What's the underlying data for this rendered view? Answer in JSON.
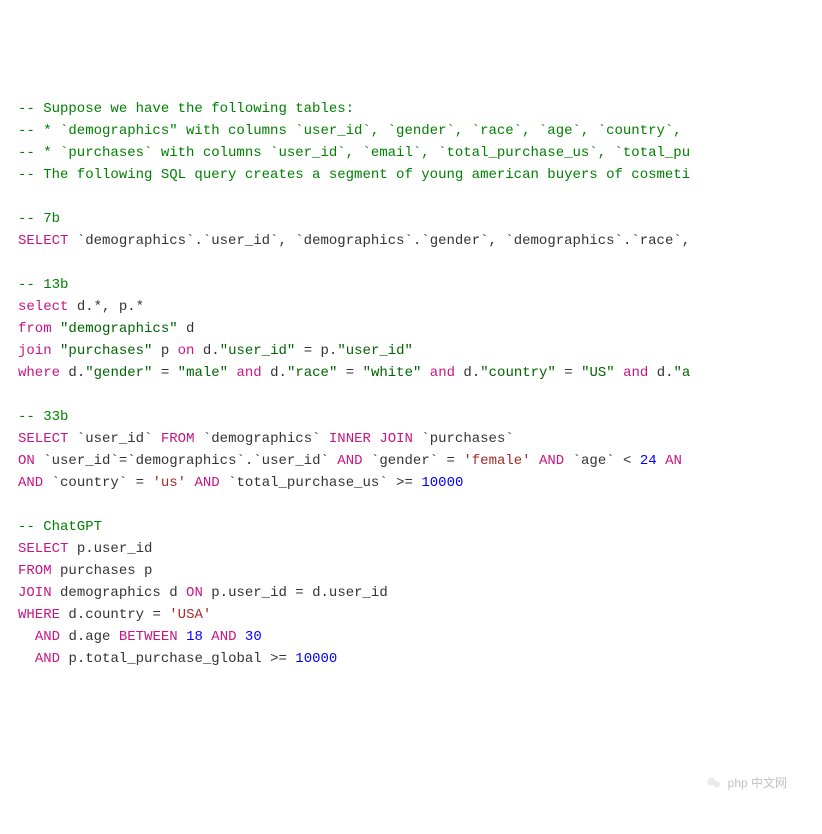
{
  "lines": [
    {
      "type": "comment",
      "text": "-- Suppose we have the following tables:"
    },
    {
      "type": "comment",
      "text": "-- * `demographics\" with columns `user_id`, `gender`, `race`, `age`, `country`, "
    },
    {
      "type": "comment",
      "text": "-- * `purchases` with columns `user_id`, `email`, `total_purchase_us`, `total_pu"
    },
    {
      "type": "comment",
      "text": "-- The following SQL query creates a segment of young american buyers of cosmeti"
    },
    {
      "type": "blank"
    },
    {
      "type": "comment",
      "text": "-- 7b"
    },
    {
      "type": "tokens",
      "tokens": [
        {
          "t": "keyword",
          "v": "SELECT"
        },
        {
          "t": "sp",
          "v": " "
        },
        {
          "t": "ident",
          "v": "`demographics`.`user_id`"
        },
        {
          "t": "op",
          "v": ", "
        },
        {
          "t": "ident",
          "v": "`demographics`.`gender`"
        },
        {
          "t": "op",
          "v": ", "
        },
        {
          "t": "ident",
          "v": "`demographics`.`race`"
        },
        {
          "t": "op",
          "v": ", "
        }
      ]
    },
    {
      "type": "blank"
    },
    {
      "type": "comment",
      "text": "-- 13b"
    },
    {
      "type": "tokens",
      "tokens": [
        {
          "t": "keyword",
          "v": "select"
        },
        {
          "t": "sp",
          "v": " "
        },
        {
          "t": "ident",
          "v": "d."
        },
        {
          "t": "op",
          "v": "*"
        },
        {
          "t": "op",
          "v": ", "
        },
        {
          "t": "ident",
          "v": "p."
        },
        {
          "t": "op",
          "v": "*"
        }
      ]
    },
    {
      "type": "tokens",
      "tokens": [
        {
          "t": "keyword",
          "v": "from"
        },
        {
          "t": "sp",
          "v": " "
        },
        {
          "t": "string",
          "v": "\"demographics\""
        },
        {
          "t": "sp",
          "v": " "
        },
        {
          "t": "ident",
          "v": "d"
        }
      ]
    },
    {
      "type": "tokens",
      "tokens": [
        {
          "t": "keyword",
          "v": "join"
        },
        {
          "t": "sp",
          "v": " "
        },
        {
          "t": "string",
          "v": "\"purchases\""
        },
        {
          "t": "sp",
          "v": " "
        },
        {
          "t": "ident",
          "v": "p"
        },
        {
          "t": "sp",
          "v": " "
        },
        {
          "t": "keyword",
          "v": "on"
        },
        {
          "t": "sp",
          "v": " "
        },
        {
          "t": "ident",
          "v": "d."
        },
        {
          "t": "string",
          "v": "\"user_id\""
        },
        {
          "t": "sp",
          "v": " "
        },
        {
          "t": "op",
          "v": "="
        },
        {
          "t": "sp",
          "v": " "
        },
        {
          "t": "ident",
          "v": "p."
        },
        {
          "t": "string",
          "v": "\"user_id\""
        }
      ]
    },
    {
      "type": "tokens",
      "tokens": [
        {
          "t": "keyword",
          "v": "where"
        },
        {
          "t": "sp",
          "v": " "
        },
        {
          "t": "ident",
          "v": "d."
        },
        {
          "t": "string",
          "v": "\"gender\""
        },
        {
          "t": "sp",
          "v": " "
        },
        {
          "t": "op",
          "v": "="
        },
        {
          "t": "sp",
          "v": " "
        },
        {
          "t": "string",
          "v": "\"male\""
        },
        {
          "t": "sp",
          "v": " "
        },
        {
          "t": "keyword",
          "v": "and"
        },
        {
          "t": "sp",
          "v": " "
        },
        {
          "t": "ident",
          "v": "d."
        },
        {
          "t": "string",
          "v": "\"race\""
        },
        {
          "t": "sp",
          "v": " "
        },
        {
          "t": "op",
          "v": "="
        },
        {
          "t": "sp",
          "v": " "
        },
        {
          "t": "string",
          "v": "\"white\""
        },
        {
          "t": "sp",
          "v": " "
        },
        {
          "t": "keyword",
          "v": "and"
        },
        {
          "t": "sp",
          "v": " "
        },
        {
          "t": "ident",
          "v": "d."
        },
        {
          "t": "string",
          "v": "\"country\""
        },
        {
          "t": "sp",
          "v": " "
        },
        {
          "t": "op",
          "v": "="
        },
        {
          "t": "sp",
          "v": " "
        },
        {
          "t": "string",
          "v": "\"US\""
        },
        {
          "t": "sp",
          "v": " "
        },
        {
          "t": "keyword",
          "v": "and"
        },
        {
          "t": "sp",
          "v": " "
        },
        {
          "t": "ident",
          "v": "d."
        },
        {
          "t": "string",
          "v": "\"a"
        }
      ]
    },
    {
      "type": "blank"
    },
    {
      "type": "comment",
      "text": "-- 33b"
    },
    {
      "type": "tokens",
      "tokens": [
        {
          "t": "keyword",
          "v": "SELECT"
        },
        {
          "t": "sp",
          "v": " "
        },
        {
          "t": "ident",
          "v": "`user_id`"
        },
        {
          "t": "sp",
          "v": " "
        },
        {
          "t": "keyword",
          "v": "FROM"
        },
        {
          "t": "sp",
          "v": " "
        },
        {
          "t": "ident",
          "v": "`demographics`"
        },
        {
          "t": "sp",
          "v": " "
        },
        {
          "t": "keyword",
          "v": "INNER JOIN"
        },
        {
          "t": "sp",
          "v": " "
        },
        {
          "t": "ident",
          "v": "`purchases`"
        }
      ]
    },
    {
      "type": "tokens",
      "tokens": [
        {
          "t": "keyword",
          "v": "ON"
        },
        {
          "t": "sp",
          "v": " "
        },
        {
          "t": "ident",
          "v": "`user_id`"
        },
        {
          "t": "op",
          "v": "="
        },
        {
          "t": "ident",
          "v": "`demographics`.`user_id`"
        },
        {
          "t": "sp",
          "v": " "
        },
        {
          "t": "keyword",
          "v": "AND"
        },
        {
          "t": "sp",
          "v": " "
        },
        {
          "t": "ident",
          "v": "`gender`"
        },
        {
          "t": "sp",
          "v": " "
        },
        {
          "t": "op",
          "v": "="
        },
        {
          "t": "sp",
          "v": " "
        },
        {
          "t": "string-single",
          "v": "'female'"
        },
        {
          "t": "sp",
          "v": " "
        },
        {
          "t": "keyword",
          "v": "AND"
        },
        {
          "t": "sp",
          "v": " "
        },
        {
          "t": "ident",
          "v": "`age`"
        },
        {
          "t": "sp",
          "v": " "
        },
        {
          "t": "op",
          "v": "<"
        },
        {
          "t": "sp",
          "v": " "
        },
        {
          "t": "number",
          "v": "24"
        },
        {
          "t": "sp",
          "v": " "
        },
        {
          "t": "keyword",
          "v": "AN"
        }
      ]
    },
    {
      "type": "tokens",
      "tokens": [
        {
          "t": "keyword",
          "v": "AND"
        },
        {
          "t": "sp",
          "v": " "
        },
        {
          "t": "ident",
          "v": "`country`"
        },
        {
          "t": "sp",
          "v": " "
        },
        {
          "t": "op",
          "v": "="
        },
        {
          "t": "sp",
          "v": " "
        },
        {
          "t": "string-single",
          "v": "'us'"
        },
        {
          "t": "sp",
          "v": " "
        },
        {
          "t": "keyword",
          "v": "AND"
        },
        {
          "t": "sp",
          "v": " "
        },
        {
          "t": "ident",
          "v": "`total_purchase_us`"
        },
        {
          "t": "sp",
          "v": " "
        },
        {
          "t": "op",
          "v": ">="
        },
        {
          "t": "sp",
          "v": " "
        },
        {
          "t": "number",
          "v": "10000"
        }
      ]
    },
    {
      "type": "blank"
    },
    {
      "type": "comment",
      "text": "-- ChatGPT"
    },
    {
      "type": "tokens",
      "tokens": [
        {
          "t": "keyword",
          "v": "SELECT"
        },
        {
          "t": "sp",
          "v": " "
        },
        {
          "t": "ident",
          "v": "p.user_id"
        }
      ]
    },
    {
      "type": "tokens",
      "tokens": [
        {
          "t": "keyword",
          "v": "FROM"
        },
        {
          "t": "sp",
          "v": " "
        },
        {
          "t": "ident",
          "v": "purchases p"
        }
      ]
    },
    {
      "type": "tokens",
      "tokens": [
        {
          "t": "keyword",
          "v": "JOIN"
        },
        {
          "t": "sp",
          "v": " "
        },
        {
          "t": "ident",
          "v": "demographics d"
        },
        {
          "t": "sp",
          "v": " "
        },
        {
          "t": "keyword",
          "v": "ON"
        },
        {
          "t": "sp",
          "v": " "
        },
        {
          "t": "ident",
          "v": "p.user_id"
        },
        {
          "t": "sp",
          "v": " "
        },
        {
          "t": "op",
          "v": "="
        },
        {
          "t": "sp",
          "v": " "
        },
        {
          "t": "ident",
          "v": "d.user_id"
        }
      ]
    },
    {
      "type": "tokens",
      "tokens": [
        {
          "t": "keyword",
          "v": "WHERE"
        },
        {
          "t": "sp",
          "v": " "
        },
        {
          "t": "ident",
          "v": "d.country"
        },
        {
          "t": "sp",
          "v": " "
        },
        {
          "t": "op",
          "v": "="
        },
        {
          "t": "sp",
          "v": " "
        },
        {
          "t": "string-single",
          "v": "'USA'"
        }
      ]
    },
    {
      "type": "tokens",
      "tokens": [
        {
          "t": "sp",
          "v": "  "
        },
        {
          "t": "keyword",
          "v": "AND"
        },
        {
          "t": "sp",
          "v": " "
        },
        {
          "t": "ident",
          "v": "d.age"
        },
        {
          "t": "sp",
          "v": " "
        },
        {
          "t": "keyword",
          "v": "BETWEEN"
        },
        {
          "t": "sp",
          "v": " "
        },
        {
          "t": "number",
          "v": "18"
        },
        {
          "t": "sp",
          "v": " "
        },
        {
          "t": "keyword",
          "v": "AND"
        },
        {
          "t": "sp",
          "v": " "
        },
        {
          "t": "number",
          "v": "30"
        }
      ]
    },
    {
      "type": "tokens",
      "tokens": [
        {
          "t": "sp",
          "v": "  "
        },
        {
          "t": "keyword",
          "v": "AND"
        },
        {
          "t": "sp",
          "v": " "
        },
        {
          "t": "ident",
          "v": "p.total_purchase_global"
        },
        {
          "t": "sp",
          "v": " "
        },
        {
          "t": "op",
          "v": ">="
        },
        {
          "t": "sp",
          "v": " "
        },
        {
          "t": "number",
          "v": "10000"
        }
      ]
    }
  ],
  "watermark": "php 中文网"
}
